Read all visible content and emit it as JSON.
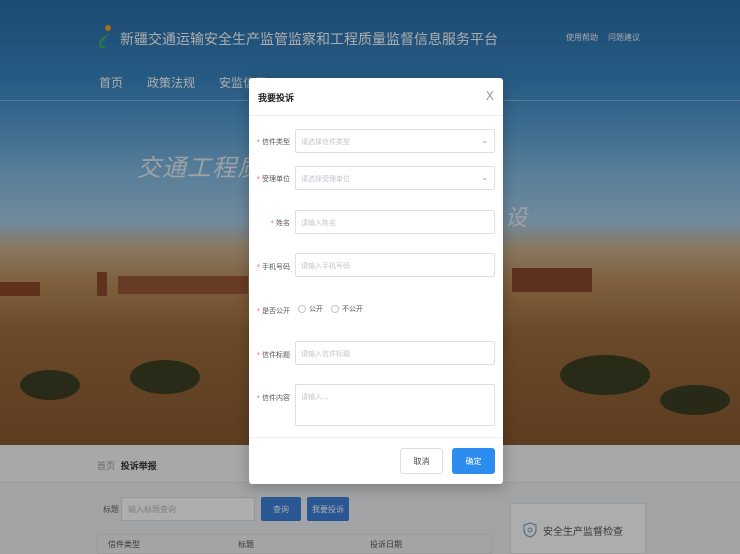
{
  "header": {
    "site_title": "新疆交通运输安全生产监管监察和工程质量监督信息服务平台",
    "top_links": [
      "使用帮助",
      "问题建议"
    ],
    "nav": [
      "首页",
      "政策法规",
      "安监信用"
    ]
  },
  "hero": {
    "slogan_main": "交通工程质量",
    "slogan_tail": "设"
  },
  "breadcrumb": {
    "home": "首页",
    "current": "投诉举报"
  },
  "search": {
    "label": "标题",
    "placeholder": "输入标题查询",
    "query_button": "查询",
    "complain_button": "我要投诉"
  },
  "table": {
    "headers": [
      "信件类型",
      "标题",
      "投诉日期"
    ]
  },
  "side_card": {
    "label": "安全生产监督检查"
  },
  "modal": {
    "title": "我要投诉",
    "close": "X",
    "fields": {
      "letter_type": {
        "label": "信件类型",
        "placeholder": "请选择信件类型"
      },
      "unit": {
        "label": "受理单位",
        "placeholder": "请选择受理单位"
      },
      "name": {
        "label": "姓名",
        "placeholder": "请输入姓名"
      },
      "phone": {
        "label": "手机号码",
        "placeholder": "请输入手机号码"
      },
      "public": {
        "label": "是否公开",
        "options": [
          "公开",
          "不公开"
        ]
      },
      "subject": {
        "label": "信件标题",
        "placeholder": "请输入信件标题"
      },
      "content": {
        "label": "信件内容",
        "placeholder": "请输入..."
      }
    },
    "required_mark": "*",
    "cancel": "取消",
    "confirm": "确定"
  },
  "colors": {
    "primary": "#2d8cf0",
    "required": "#f56c6c"
  }
}
